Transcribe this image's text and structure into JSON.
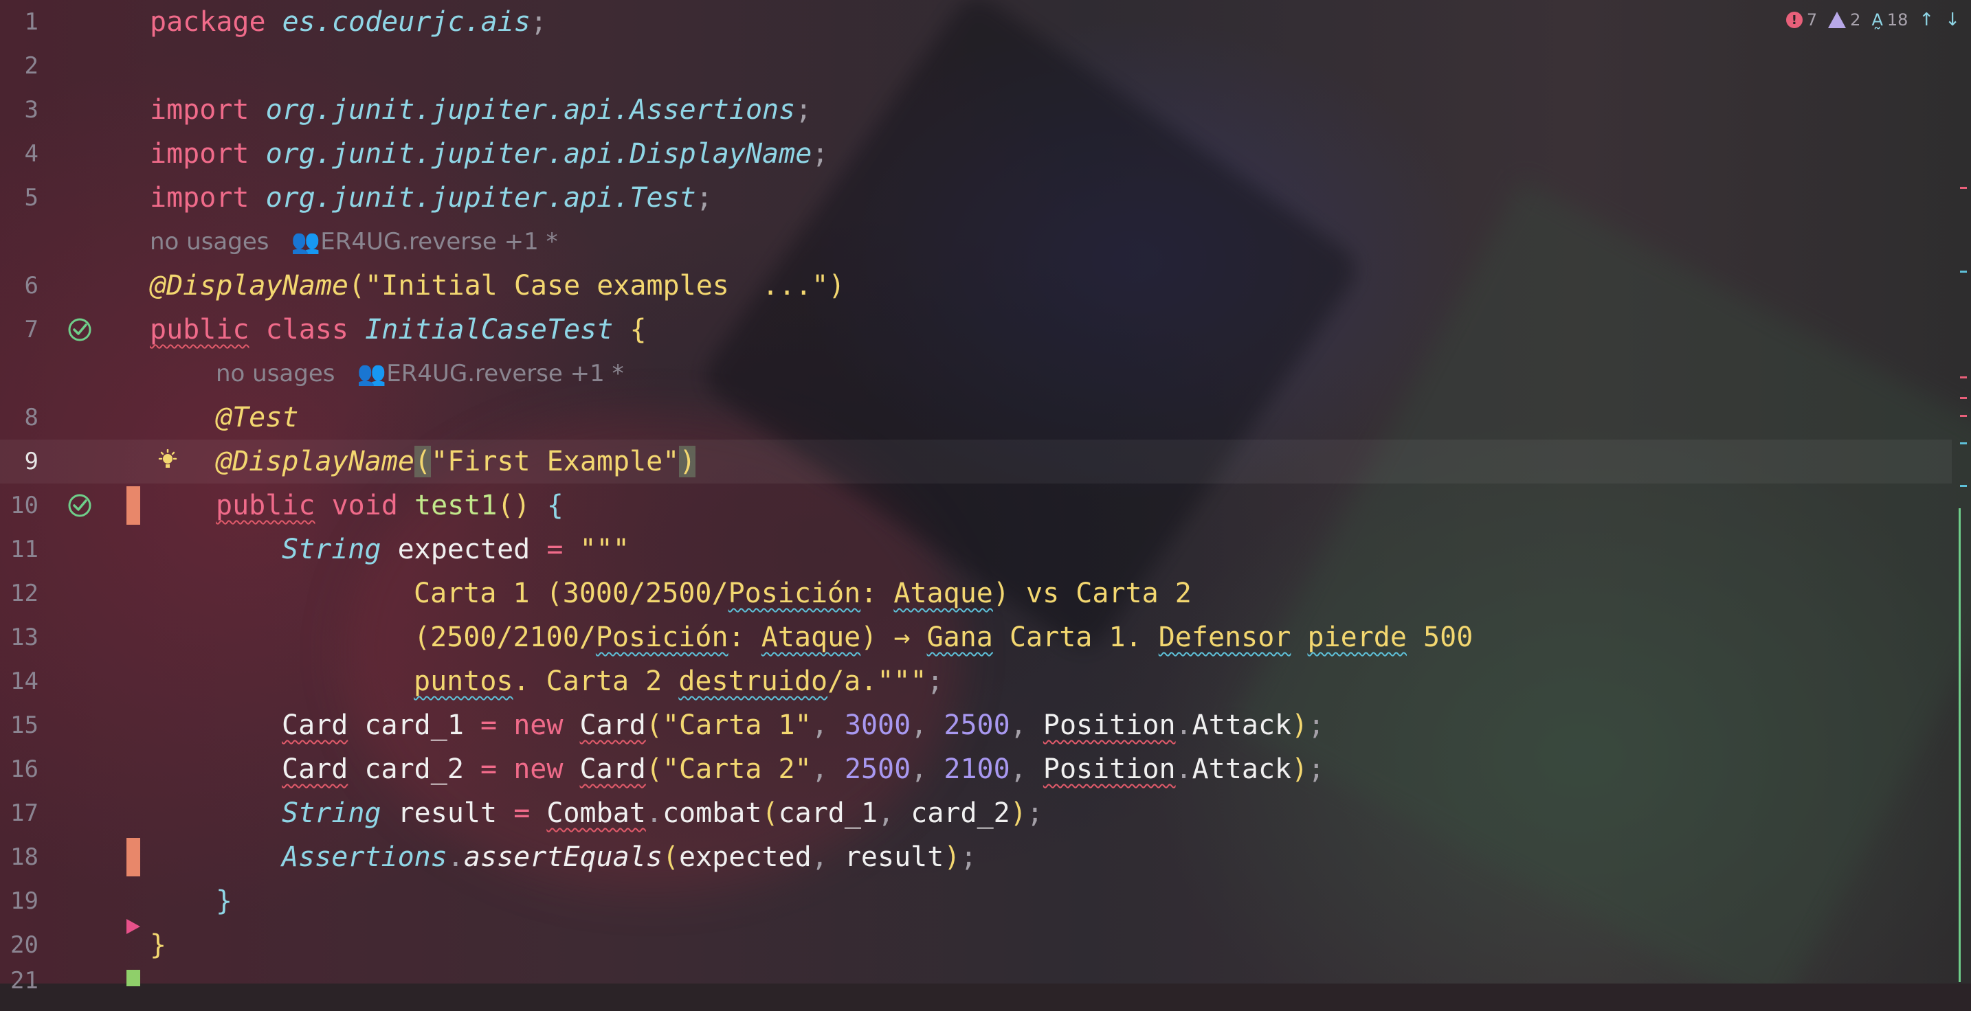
{
  "inspections": {
    "errors": "7",
    "warnings": "2",
    "typos": "18"
  },
  "hints": {
    "usages": "no usages",
    "authors": "ER4UG.reverse +1 *"
  },
  "lines": {
    "l1": {
      "n": "1"
    },
    "l2": {
      "n": "2"
    },
    "l3": {
      "n": "3"
    },
    "l4": {
      "n": "4"
    },
    "l5": {
      "n": "5"
    },
    "l6": {
      "n": "6"
    },
    "l7": {
      "n": "7"
    },
    "l8": {
      "n": "8"
    },
    "l9": {
      "n": "9"
    },
    "l10": {
      "n": "10"
    },
    "l11": {
      "n": "11"
    },
    "l12": {
      "n": "12"
    },
    "l13": {
      "n": "13"
    },
    "l14": {
      "n": "14"
    },
    "l15": {
      "n": "15"
    },
    "l16": {
      "n": "16"
    },
    "l17": {
      "n": "17"
    },
    "l18": {
      "n": "18"
    },
    "l19": {
      "n": "19"
    },
    "l20": {
      "n": "20"
    }
  },
  "code": {
    "package_kw": "package",
    "package_name": "es.codeurjc.ais",
    "semi": ";",
    "import_kw": "import",
    "import1": "org.junit.jupiter.api.Assertions",
    "import2": "org.junit.jupiter.api.DisplayName",
    "import3": "org.junit.jupiter.api.Test",
    "display_ann": "@DisplayName",
    "class_display": "\"Initial Case examples  ...\"",
    "public_kw": "public",
    "class_kw": "class",
    "class_name": "InitialCaseTest",
    "test_ann": "@Test",
    "method_display": "\"First Example\"",
    "void_kw": "void",
    "method_name": "test1",
    "string_type": "String",
    "expected_var": "expected",
    "triple_quote": "\"\"\"",
    "t12a": "Carta 1 (3000/2500/",
    "t12b": "Posición",
    "t12c": ": ",
    "t12d": "Ataque",
    "t12e": ") vs Carta 2",
    "t13a": "(2500/2100/",
    "t13b": "Posición",
    "t13c": ": ",
    "t13d": "Ataque",
    "t13e": ") → ",
    "t13f": "Gana",
    "t13g": " Carta 1. ",
    "t13h": "Defensor",
    "t13i": " ",
    "t13j": "pierde",
    "t13k": " 500",
    "t14a": "puntos",
    "t14b": ". Carta 2 ",
    "t14c": "destruido",
    "t14d": "/a.\"\"\"",
    "card_type": "Card",
    "card1_var": "card_1",
    "card2_var": "card_2",
    "new_kw": "new",
    "carta1_str": "\"Carta 1\"",
    "carta2_str": "\"Carta 2\"",
    "n3000": "3000",
    "n2500": "2500",
    "n2100": "2100",
    "position_cls": "Position",
    "attack": "Attack",
    "result_var": "result",
    "combat_cls": "Combat",
    "combat_fn": "combat",
    "assertions_cls": "Assertions",
    "assert_fn": "assertEquals"
  }
}
